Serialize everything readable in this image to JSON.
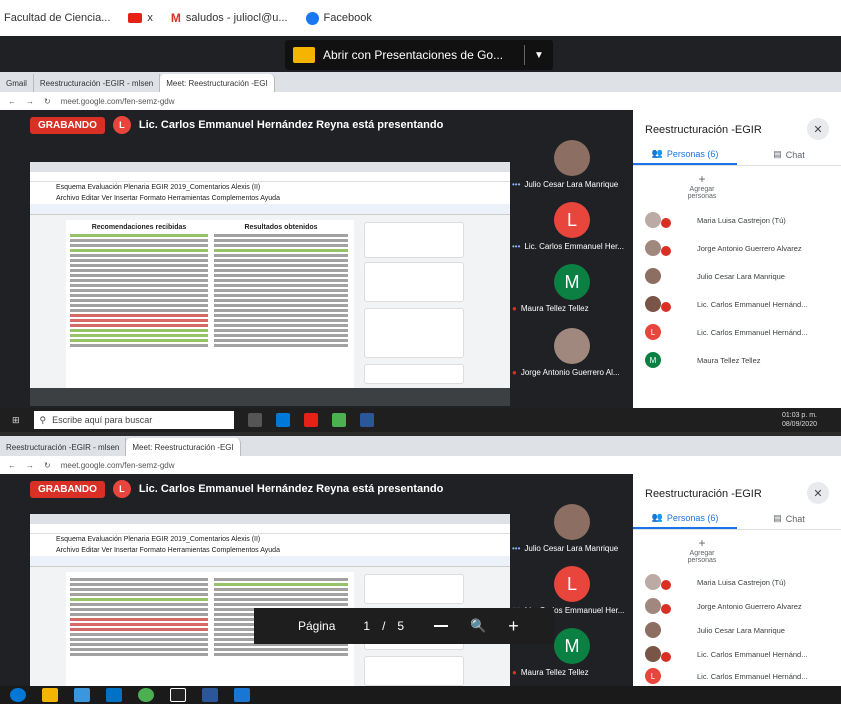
{
  "bookmarks": [
    {
      "label": "Facultad de Ciencia..."
    },
    {
      "label": "x"
    },
    {
      "label": "saludos - juliocl@u..."
    },
    {
      "label": "Facebook"
    }
  ],
  "slides_popup": {
    "label": "Abrir con Presentaciones de Go...",
    "arrow": "▼"
  },
  "top": {
    "tabs": [
      {
        "label": "Gmail"
      },
      {
        "label": "Reestructuración -EGIR - mlsen"
      },
      {
        "label": "Meet: Reestructuración -EGI"
      }
    ],
    "url": "meet.google.com/fen-semz-gdw",
    "recording_label": "GRABANDO",
    "presenter_initial": "L",
    "presenting_text": "Lic. Carlos Emmanuel Hernández Reyna está presentando",
    "doc_title": "Esquema Evaluación Plenaria EGIR 2019_Comentarios Alexis (II)",
    "doc_menu": "Archivo  Editar  Ver  Insertar  Formato  Herramientas  Complementos  Ayuda",
    "col1_header": "Recomendaciones recibidas",
    "col2_header": "Resultados obtenidos",
    "tiles": [
      {
        "name": "Julio Cesar Lara Manrique",
        "initial": ""
      },
      {
        "name": "Lic. Carlos Emmanuel Her...",
        "initial": "L"
      },
      {
        "name": "Maura Tellez Tellez",
        "initial": "M"
      },
      {
        "name": "Jorge Antonio Guerrero Al...",
        "initial": ""
      }
    ],
    "panel": {
      "title": "Reestructuración -EGIR",
      "close": "✕",
      "people_tab": "Personas (6)",
      "chat_tab": "Chat",
      "add": "Agregar personas",
      "people": [
        {
          "name": "Maria Luisa Castrejon (Tú)",
          "initial": ""
        },
        {
          "name": "Jorge Antonio Guerrero Alvarez",
          "initial": ""
        },
        {
          "name": "Julio Cesar Lara Manrique",
          "initial": ""
        },
        {
          "name": "Lic. Carlos Emmanuel Hernánd...",
          "initial": ""
        },
        {
          "name": "Lic. Carlos Emmanuel Hernánd...",
          "initial": "L"
        },
        {
          "name": "Maura Tellez Tellez",
          "initial": "M"
        }
      ]
    },
    "taskbar": {
      "search": "Escribe aquí para buscar",
      "time": "01:03 p. m.",
      "date": "08/09/2020"
    }
  },
  "bottom": {
    "tabs": [
      {
        "label": "Reestructuración -EGIR - mlsen"
      },
      {
        "label": "Meet: Reestructuración -EGI"
      }
    ],
    "url": "meet.google.com/fen-semz-gdw",
    "recording_label": "GRABANDO",
    "presenter_initial": "L",
    "presenting_text": "Lic. Carlos Emmanuel Hernández Reyna está presentando",
    "doc_title": "Esquema Evaluación Plenaria EGIR 2019_Comentarios Alexis (II)",
    "doc_menu": "Archivo  Editar  Ver  Insertar  Formato  Herramientas  Complementos  Ayuda",
    "tiles": [
      {
        "name": "Julio Cesar Lara Manrique",
        "initial": ""
      },
      {
        "name": "Lic. Carlos Emmanuel Her...",
        "initial": "L"
      },
      {
        "name": "Maura Tellez Tellez",
        "initial": "M"
      }
    ],
    "panel": {
      "title": "Reestructuración -EGIR",
      "close": "✕",
      "people_tab": "Personas (6)",
      "chat_tab": "Chat",
      "add": "Agregar personas",
      "people": [
        {
          "name": "Maria Luisa Castrejon (Tú)",
          "initial": ""
        },
        {
          "name": "Jorge Antonio Guerrero Alvarez",
          "initial": ""
        },
        {
          "name": "Julio Cesar Lara Manrique",
          "initial": ""
        },
        {
          "name": "Lic. Carlos Emmanuel Hernánd...",
          "initial": ""
        },
        {
          "name": "Lic. Carlos Emmanuel Hernánd...",
          "initial": "L"
        }
      ]
    }
  },
  "page_nav": {
    "label": "Página",
    "current": "1",
    "slash": "/",
    "total": "5",
    "zoom_icon": "🔍",
    "plus": "+"
  },
  "colors": {
    "meet_bg": "#202124",
    "record_red": "#d93025",
    "accent_blue": "#1a73e8",
    "slides_yellow": "#f4b400"
  }
}
